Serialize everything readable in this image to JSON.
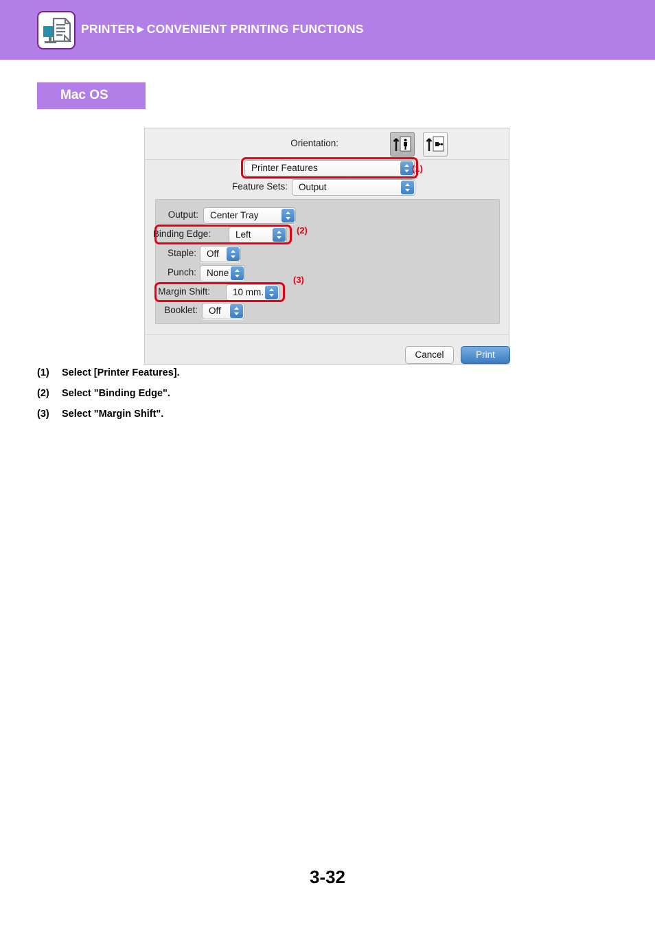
{
  "header": {
    "title": "PRINTER►CONVENIENT PRINTING FUNCTIONS",
    "icon": "printer-document-icon",
    "bar_color": "#b27ee8",
    "icon_border_color": "#7b1f8e"
  },
  "section": {
    "chip_label": "Mac OS",
    "chip_color": "#b27ee8"
  },
  "dialog": {
    "orientation": {
      "label": "Orientation:",
      "options": [
        "portrait",
        "landscape"
      ],
      "selected": "portrait"
    },
    "feature_menu": {
      "value": "Printer Features"
    },
    "feature_sets": {
      "label": "Feature Sets:",
      "value": "Output"
    },
    "settings": [
      {
        "label": "Output:",
        "value": "Center Tray"
      },
      {
        "label": "Binding Edge:",
        "value": "Left"
      },
      {
        "label": "Staple:",
        "value": "Off"
      },
      {
        "label": "Punch:",
        "value": "None"
      },
      {
        "label": "Margin Shift:",
        "value": "10 mm."
      },
      {
        "label": "Booklet:",
        "value": "Off"
      }
    ],
    "buttons": {
      "cancel": "Cancel",
      "print": "Print"
    }
  },
  "callouts": {
    "one": "(1)",
    "two": "(2)",
    "three": "(3)",
    "color": "#e60012"
  },
  "steps": [
    {
      "num": "(1)",
      "text": "Select [Printer Features]."
    },
    {
      "num": "(2)",
      "text": "Select \"Binding Edge\"."
    },
    {
      "num": "(3)",
      "text": "Select \"Margin Shift\"."
    }
  ],
  "footer": {
    "page_number": "3-32"
  }
}
